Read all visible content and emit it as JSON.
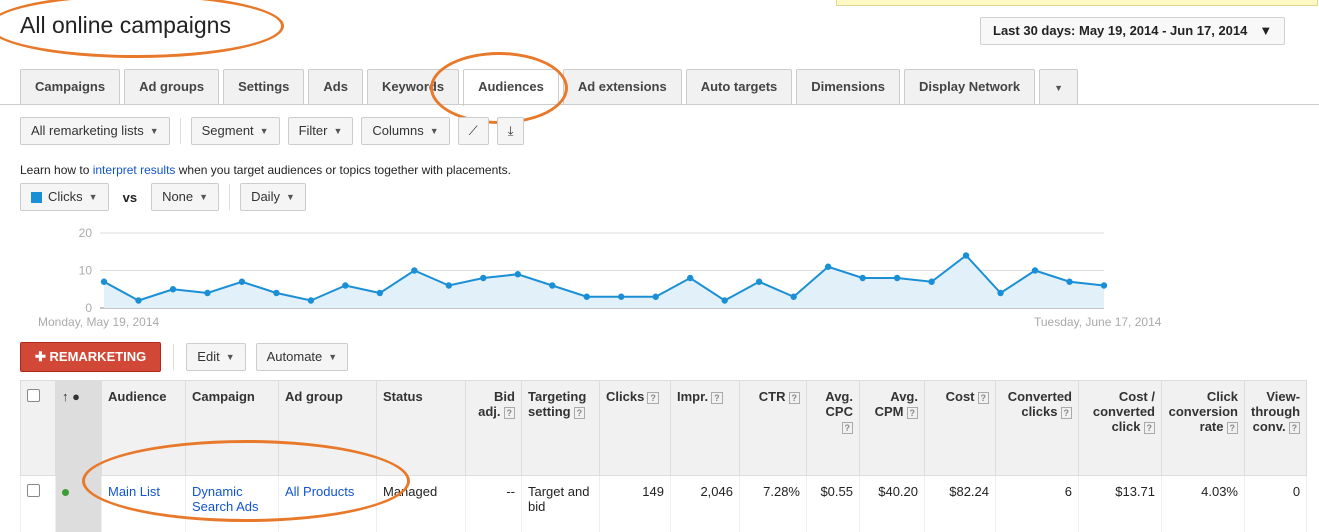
{
  "title": "All online campaigns",
  "date_range": "Last 30 days: May 19, 2014 - Jun 17, 2014",
  "tabs": [
    "Campaigns",
    "Ad groups",
    "Settings",
    "Ads",
    "Keywords",
    "Audiences",
    "Ad extensions",
    "Auto targets",
    "Dimensions",
    "Display Network"
  ],
  "toolbar": {
    "lists": "All remarketing lists",
    "segment": "Segment",
    "filter": "Filter",
    "columns": "Columns"
  },
  "learn": {
    "prefix": "Learn how to ",
    "link": "interpret results",
    "suffix": " when you target audiences or topics together with placements."
  },
  "metric": {
    "primary": "Clicks",
    "vs": "vs",
    "secondary": "None",
    "period": "Daily"
  },
  "chart_data": {
    "type": "line",
    "series": [
      {
        "values": [
          7,
          2,
          5,
          4,
          7,
          4,
          2,
          6,
          4,
          10,
          6,
          8,
          9,
          6,
          3,
          3,
          3,
          8,
          2,
          7,
          3,
          11,
          8,
          8,
          7,
          14,
          4,
          10,
          7,
          6
        ]
      }
    ],
    "y_ticks": [
      "0",
      "10",
      "20"
    ],
    "ylim": [
      0,
      20
    ],
    "x_start": "Monday, May 19, 2014",
    "x_end": "Tuesday, June 17, 2014",
    "line_color": "#1a8fd6",
    "area_color": "#e2f0f9"
  },
  "actions": {
    "remarketing": "REMARKETING",
    "edit": "Edit",
    "automate": "Automate"
  },
  "table": {
    "headers": {
      "audience": "Audience",
      "campaign": "Campaign",
      "adgroup": "Ad group",
      "status": "Status",
      "bidadj": "Bid adj.",
      "targeting": "Targeting setting",
      "clicks": "Clicks",
      "impr": "Impr.",
      "ctr": "CTR",
      "cpc": "Avg. CPC",
      "cpm": "Avg. CPM",
      "cost": "Cost",
      "conv": "Converted clicks",
      "costconv": "Cost / converted click",
      "rate": "Click conversion rate",
      "view": "View-through conv."
    },
    "rows": [
      {
        "audience": "Main List",
        "campaign": "Dynamic Search Ads",
        "adgroup": "All Products",
        "status": "Managed",
        "bidadj": "--",
        "targeting": "Target and bid",
        "clicks": "149",
        "impr": "2,046",
        "ctr": "7.28%",
        "cpc": "$0.55",
        "cpm": "$40.20",
        "cost": "$82.24",
        "conv": "6",
        "costconv": "$13.71",
        "rate": "4.03%",
        "view": "0"
      }
    ]
  },
  "colors": {
    "accent": "#1155cc",
    "brand_red": "#d14836",
    "highlight": "#e8792a"
  }
}
